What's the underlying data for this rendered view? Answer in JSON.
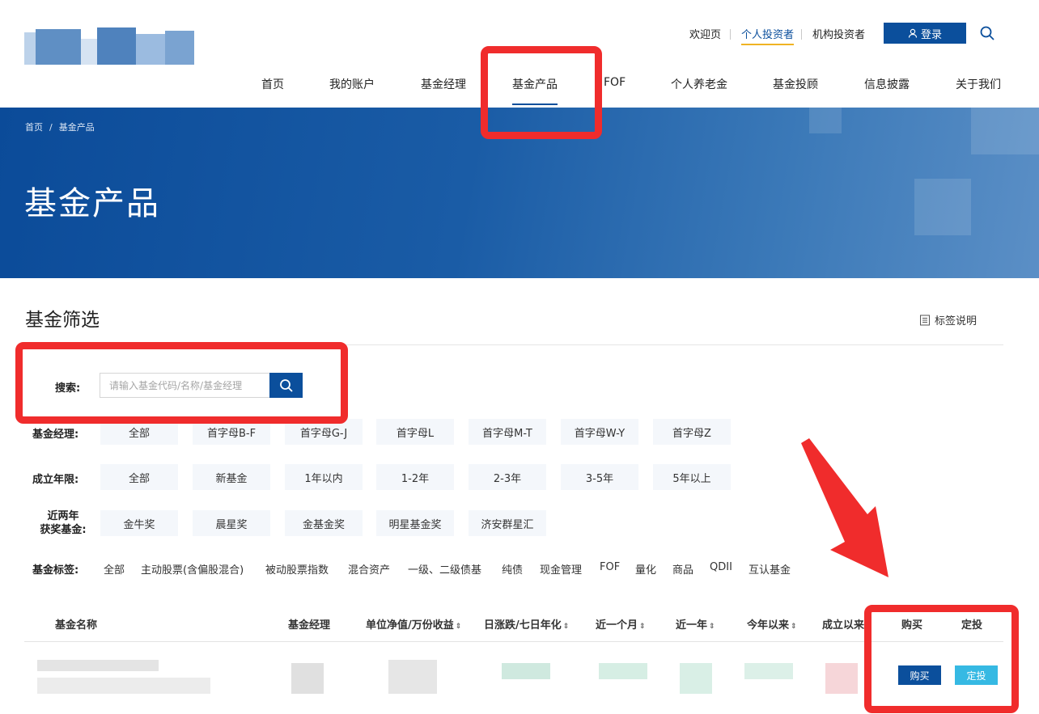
{
  "header": {
    "logo_icon": "brand-logo-pixelated",
    "top_links": [
      "欢迎页",
      "个人投资者",
      "机构投资者"
    ],
    "login_label": "登录",
    "login_icon": "user-icon",
    "search_icon": "search-icon",
    "nav": [
      "首页",
      "我的账户",
      "基金经理",
      "基金产品",
      "FOF",
      "个人养老金",
      "基金投顾",
      "信息披露",
      "关于我们"
    ],
    "active_nav": "基金产品",
    "brand_color": "#0b4f9c",
    "accent_color": "#f0b323"
  },
  "banner": {
    "breadcrumb": [
      "首页",
      "基金产品"
    ],
    "title": "基金产品"
  },
  "filter": {
    "title": "基金筛选",
    "tag_help": "标签说明",
    "search_label": "搜索:",
    "search_placeholder": "请输入基金代码/名称/基金经理",
    "rows": {
      "manager": {
        "label": "基金经理:",
        "options": [
          "全部",
          "首字母B-F",
          "首字母G-J",
          "首字母L",
          "首字母M-T",
          "首字母W-Y",
          "首字母Z"
        ]
      },
      "period": {
        "label": "成立年限:",
        "options": [
          "全部",
          "新基金",
          "1年以内",
          "1-2年",
          "2-3年",
          "3-5年",
          "5年以上"
        ]
      },
      "award": {
        "label_line1": "近两年",
        "label_line2": "获奖基金:",
        "options": [
          "金牛奖",
          "晨星奖",
          "金基金奖",
          "明星基金奖",
          "济安群星汇"
        ]
      },
      "tags": {
        "label": "基金标签:",
        "options": [
          "全部",
          "主动股票(含偏股混合)",
          "被动股票指数",
          "混合资产",
          "一级、二级债基",
          "纯债",
          "现金管理",
          "FOF",
          "量化",
          "商品",
          "QDII",
          "互认基金"
        ]
      }
    }
  },
  "table": {
    "headers": [
      "基金名称",
      "基金经理",
      "单位净值/万份收益",
      "日涨跌/七日年化",
      "近一个月",
      "近一年",
      "今年以来",
      "成立以来",
      "购买",
      "定投"
    ],
    "sortable": [
      false,
      false,
      true,
      true,
      true,
      true,
      true,
      false,
      false,
      false
    ],
    "row_buttons": {
      "buy": "购买",
      "plan": "定投"
    }
  },
  "annotations": {
    "color": "#f02c2c"
  }
}
